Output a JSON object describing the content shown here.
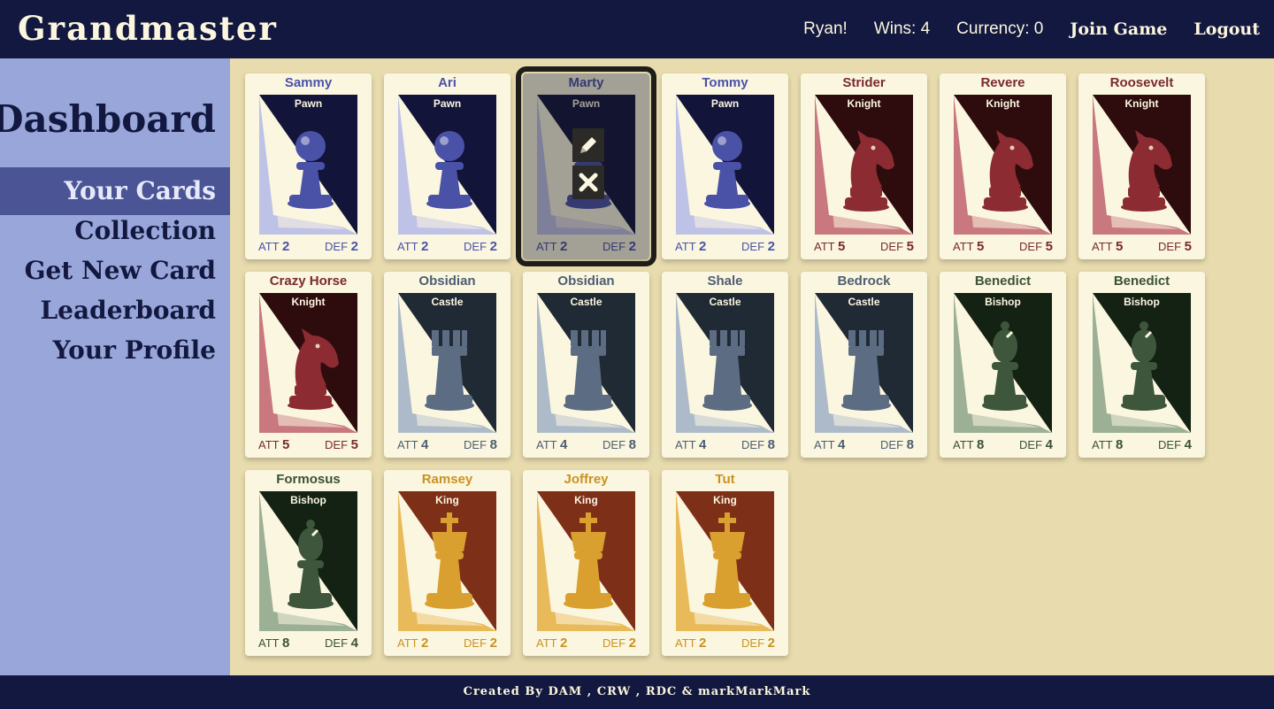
{
  "brand": "Grandmaster",
  "header": {
    "user": "Ryan!",
    "wins": "Wins: 4",
    "currency": "Currency: 0",
    "join_game": "Join Game",
    "logout": "Logout"
  },
  "sidebar": {
    "title": "Dashboard",
    "items": [
      {
        "label": "Your Cards",
        "active": true
      },
      {
        "label": "Collection",
        "active": false
      },
      {
        "label": "Get New Card",
        "active": false
      },
      {
        "label": "Leaderboard",
        "active": false
      },
      {
        "label": "Your Profile",
        "active": false
      }
    ]
  },
  "stat_labels": {
    "att": "ATT",
    "def": "DEF"
  },
  "piece_colors": {
    "Pawn": {
      "dark": "#12143a",
      "piece": "#4a52a8",
      "accent": "#b7bde8",
      "text": "#4a52a8"
    },
    "Knight": {
      "dark": "#2e0c0e",
      "piece": "#8c2b32",
      "accent": "#c26a73",
      "text": "#7a2a2e"
    },
    "Castle": {
      "dark": "#1f2a35",
      "piece": "#5c6c82",
      "accent": "#a4b4c6",
      "text": "#4d5e72"
    },
    "Bishop": {
      "dark": "#142214",
      "piece": "#3e573c",
      "accent": "#90a88c",
      "text": "#3b5138"
    },
    "King": {
      "dark": "#7e2f18",
      "piece": "#d9a02f",
      "accent": "#e7b44a",
      "text": "#c99220"
    }
  },
  "cards": [
    {
      "name": "Sammy",
      "type": "Pawn",
      "att": "2",
      "def": "2",
      "selected": false
    },
    {
      "name": "Ari",
      "type": "Pawn",
      "att": "2",
      "def": "2",
      "selected": false
    },
    {
      "name": "Marty",
      "type": "Pawn",
      "att": "2",
      "def": "2",
      "selected": true
    },
    {
      "name": "Tommy",
      "type": "Pawn",
      "att": "2",
      "def": "2",
      "selected": false
    },
    {
      "name": "Strider",
      "type": "Knight",
      "att": "5",
      "def": "5",
      "selected": false
    },
    {
      "name": "Revere",
      "type": "Knight",
      "att": "5",
      "def": "5",
      "selected": false
    },
    {
      "name": "Roosevelt",
      "type": "Knight",
      "att": "5",
      "def": "5",
      "selected": false
    },
    {
      "name": "Crazy Horse",
      "type": "Knight",
      "att": "5",
      "def": "5",
      "selected": false
    },
    {
      "name": "Obsidian",
      "type": "Castle",
      "att": "4",
      "def": "8",
      "selected": false
    },
    {
      "name": "Obsidian",
      "type": "Castle",
      "att": "4",
      "def": "8",
      "selected": false
    },
    {
      "name": "Shale",
      "type": "Castle",
      "att": "4",
      "def": "8",
      "selected": false
    },
    {
      "name": "Bedrock",
      "type": "Castle",
      "att": "4",
      "def": "8",
      "selected": false
    },
    {
      "name": "Benedict",
      "type": "Bishop",
      "att": "8",
      "def": "4",
      "selected": false
    },
    {
      "name": "Benedict",
      "type": "Bishop",
      "att": "8",
      "def": "4",
      "selected": false
    },
    {
      "name": "Formosus",
      "type": "Bishop",
      "att": "8",
      "def": "4",
      "selected": false
    },
    {
      "name": "Ramsey",
      "type": "King",
      "att": "2",
      "def": "2",
      "selected": false
    },
    {
      "name": "Joffrey",
      "type": "King",
      "att": "2",
      "def": "2",
      "selected": false
    },
    {
      "name": "Tut",
      "type": "King",
      "att": "2",
      "def": "2",
      "selected": false
    }
  ],
  "card_icons": {
    "edit": "pencil-icon",
    "delete": "close-icon"
  },
  "footer": "Created By DAM , CRW , RDC & markMarkMark"
}
